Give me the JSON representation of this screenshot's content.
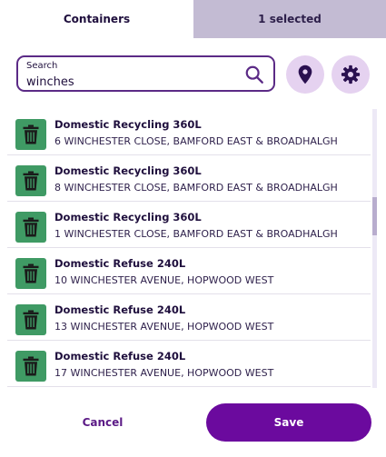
{
  "tabs": {
    "containers": "Containers",
    "selected": "1 selected"
  },
  "search": {
    "label": "Search",
    "value": "winches"
  },
  "icons": {
    "search": "search-icon",
    "location": "map-pin-icon",
    "settings": "gear-icon",
    "bin": "trash-icon"
  },
  "colors": {
    "accent": "#6b0a9e",
    "bin_tile": "#3f9a64",
    "tab_inactive": "#c3bbd3",
    "round_button": "#e5d2f0"
  },
  "containers": [
    {
      "title": "Domestic Recycling 360L",
      "address": "6 WINCHESTER CLOSE, BAMFORD EAST & BROADHALGH"
    },
    {
      "title": "Domestic Recycling 360L",
      "address": "8 WINCHESTER CLOSE, BAMFORD EAST & BROADHALGH"
    },
    {
      "title": "Domestic Recycling 360L",
      "address": "1 WINCHESTER CLOSE, BAMFORD EAST & BROADHALGH"
    },
    {
      "title": "Domestic Refuse 240L",
      "address": "10 WINCHESTER AVENUE, HOPWOOD WEST"
    },
    {
      "title": "Domestic Refuse 240L",
      "address": "13 WINCHESTER AVENUE, HOPWOOD WEST"
    },
    {
      "title": "Domestic Refuse 240L",
      "address": "17 WINCHESTER AVENUE, HOPWOOD WEST"
    }
  ],
  "actions": {
    "cancel": "Cancel",
    "save": "Save"
  }
}
